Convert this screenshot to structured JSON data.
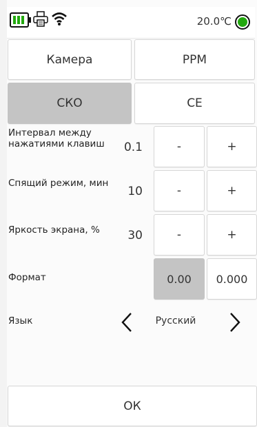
{
  "status": {
    "temperature": "20.0℃",
    "battery_color": "#22a80e",
    "led_color": "#22a80e",
    "icons": [
      "battery-icon",
      "printer-icon",
      "wifi-icon",
      "status-led-icon"
    ]
  },
  "tabs": {
    "camera": "Камера",
    "ppm": "PPM",
    "sko": "СКО",
    "ce": "СЕ"
  },
  "settings": {
    "interval": {
      "label": "Интервал между нажатиями клавиш",
      "value": "0.1",
      "minus": "-",
      "plus": "+"
    },
    "sleep": {
      "label": "Спящий режим, мин",
      "value": "10",
      "minus": "-",
      "plus": "+"
    },
    "brightness": {
      "label": "Яркость экрана, %",
      "value": "30",
      "minus": "-",
      "plus": "+"
    },
    "format": {
      "label": "Формат",
      "option1": "0.00",
      "option2": "0.000",
      "selected": "0.00"
    },
    "language": {
      "label": "Язык",
      "value": "Русский"
    }
  },
  "ok_label": "ОК"
}
